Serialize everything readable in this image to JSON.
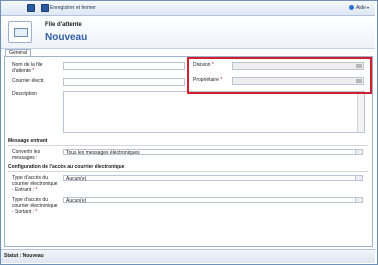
{
  "toolbar": {
    "save_close_label": "Enregistrer et fermer",
    "help_label": "Aide"
  },
  "header": {
    "entity_type": "File d'attente",
    "record_title": "Nouveau"
  },
  "tabs": [
    {
      "label": "Général"
    }
  ],
  "form": {
    "queue_name_label": "Nom de la file d'attente",
    "email_label": "Courrier électr.",
    "description_label": "Description",
    "division_label": "Division",
    "owner_label": "Propriétaire",
    "incoming_section": "Message entrant",
    "convert_label": "Convertir les messages :",
    "convert_value": "Tous les messages électroniques",
    "email_config_section": "Configuration de l'accès au courrier électronique",
    "incoming_access_label": "Type d'accès du courrier électronique - Entrant :",
    "incoming_access_value": "Aucun(e)",
    "outgoing_access_label": "Type d'accès du courrier électronique - Sortant :",
    "outgoing_access_value": "Aucun(e)",
    "required_marker": "*"
  },
  "status": {
    "text": "Statut : Nouveau"
  }
}
